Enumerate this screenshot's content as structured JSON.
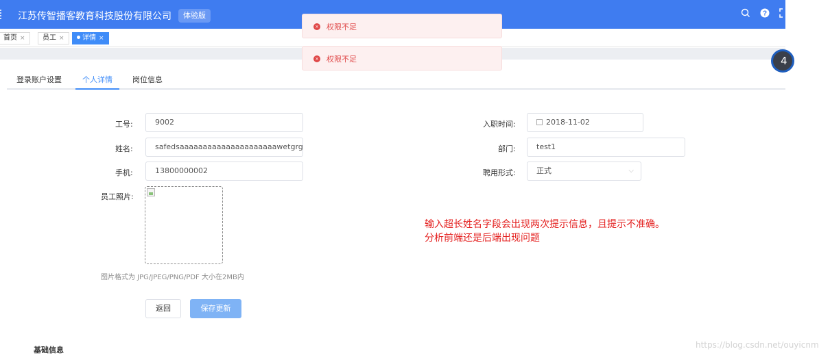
{
  "header": {
    "app_title": "江苏传智播客教育科技股份有限公司",
    "trial_badge": "体验版"
  },
  "tags": [
    {
      "label": "首页",
      "close": "×"
    },
    {
      "label": "员工",
      "close": "×"
    },
    {
      "label": "详情",
      "close": "×"
    }
  ],
  "notifications": [
    {
      "message": "权限不足"
    },
    {
      "message": "权限不足"
    }
  ],
  "float_badge": "4",
  "tabs": [
    {
      "label": "登录账户设置"
    },
    {
      "label": "个人详情"
    },
    {
      "label": "岗位信息"
    }
  ],
  "form": {
    "job_number_label": "工号:",
    "job_number_value": "9002",
    "name_label": "姓名:",
    "name_value": "safedsaaaaaaaaaaaaaaaaaaaaawetgrgfsdl",
    "phone_label": "手机:",
    "phone_value": "13800000002",
    "photo_label": "员工照片:",
    "hire_date_label": "入职时间:",
    "hire_date_value": "2018-11-02",
    "department_label": "部门:",
    "department_value": "test1",
    "employment_label": "聘用形式:",
    "employment_value": "正式",
    "photo_hint": "图片格式为 JPG/JPEG/PNG/PDF 大小在2MB内",
    "back_button": "返回",
    "save_button": "保存更新"
  },
  "section_title": "基础信息",
  "annotation": {
    "line1": "输入超长姓名字段会出现两次提示信息，且提示不准确。",
    "line2": "分析前端还是后端出现问题"
  },
  "watermark": "https://blog.csdn.net/ouyicnm"
}
